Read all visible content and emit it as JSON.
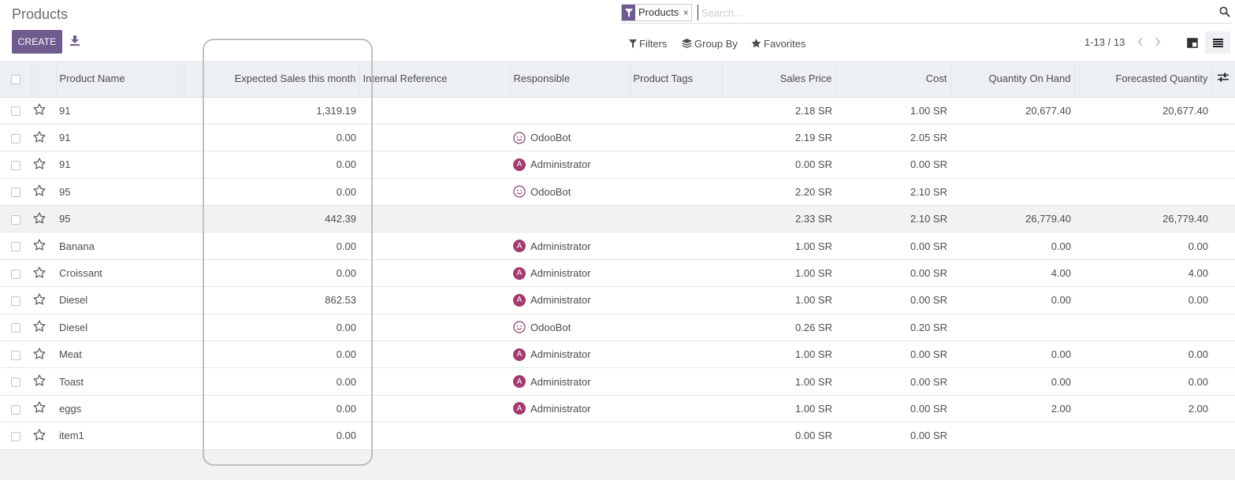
{
  "page": {
    "title": "Products"
  },
  "toolbar": {
    "create_label": "CREATE"
  },
  "search": {
    "facet_label": "Products",
    "facet_close": "×",
    "placeholder": "Search..."
  },
  "filters": {
    "filters_label": "Filters",
    "groupby_label": "Group By",
    "favorites_label": "Favorites"
  },
  "pager": {
    "value": "1-13 / 13"
  },
  "columns": {
    "name": "Product Name",
    "expected_sales": "Expected Sales this month",
    "internal_ref": "Internal Reference",
    "responsible": "Responsible",
    "tags": "Product Tags",
    "sales_price": "Sales Price",
    "cost": "Cost",
    "qty_on_hand": "Quantity On Hand",
    "forecast_qty": "Forecasted Quantity"
  },
  "rows": [
    {
      "name": "91",
      "expected": "1,319.19",
      "responsible": "",
      "avatar": "",
      "price": "2.18 SR",
      "cost": "1.00 SR",
      "qoh": "20,677.40",
      "fq": "20,677.40"
    },
    {
      "name": "91",
      "expected": "0.00",
      "responsible": "OdooBot",
      "avatar": "bot",
      "price": "2.19 SR",
      "cost": "2.05 SR",
      "qoh": "",
      "fq": ""
    },
    {
      "name": "91",
      "expected": "0.00",
      "responsible": "Administrator",
      "avatar": "A",
      "price": "0.00 SR",
      "cost": "0.00 SR",
      "qoh": "",
      "fq": ""
    },
    {
      "name": "95",
      "expected": "0.00",
      "responsible": "OdooBot",
      "avatar": "bot",
      "price": "2.20 SR",
      "cost": "2.10 SR",
      "qoh": "",
      "fq": ""
    },
    {
      "name": "95",
      "expected": "442.39",
      "responsible": "",
      "avatar": "",
      "price": "2.33 SR",
      "cost": "2.10 SR",
      "qoh": "26,779.40",
      "fq": "26,779.40"
    },
    {
      "name": "Banana",
      "expected": "0.00",
      "responsible": "Administrator",
      "avatar": "A",
      "price": "1.00 SR",
      "cost": "0.00 SR",
      "qoh": "0.00",
      "fq": "0.00"
    },
    {
      "name": "Croissant",
      "expected": "0.00",
      "responsible": "Administrator",
      "avatar": "A",
      "price": "1.00 SR",
      "cost": "0.00 SR",
      "qoh": "4.00",
      "fq": "4.00"
    },
    {
      "name": "Diesel",
      "expected": "862.53",
      "responsible": "Administrator",
      "avatar": "A",
      "price": "1.00 SR",
      "cost": "0.00 SR",
      "qoh": "0.00",
      "fq": "0.00"
    },
    {
      "name": "Diesel",
      "expected": "0.00",
      "responsible": "OdooBot",
      "avatar": "bot",
      "price": "0.26 SR",
      "cost": "0.20 SR",
      "qoh": "",
      "fq": ""
    },
    {
      "name": "Meat",
      "expected": "0.00",
      "responsible": "Administrator",
      "avatar": "A",
      "price": "1.00 SR",
      "cost": "0.00 SR",
      "qoh": "0.00",
      "fq": "0.00"
    },
    {
      "name": "Toast",
      "expected": "0.00",
      "responsible": "Administrator",
      "avatar": "A",
      "price": "1.00 SR",
      "cost": "0.00 SR",
      "qoh": "0.00",
      "fq": "0.00"
    },
    {
      "name": "eggs",
      "expected": "0.00",
      "responsible": "Administrator",
      "avatar": "A",
      "price": "1.00 SR",
      "cost": "0.00 SR",
      "qoh": "2.00",
      "fq": "2.00"
    },
    {
      "name": "item1",
      "expected": "0.00",
      "responsible": "",
      "avatar": "",
      "price": "0.00 SR",
      "cost": "0.00 SR",
      "qoh": "",
      "fq": ""
    }
  ],
  "icons": {
    "facet": "filter-icon",
    "download": "download-icon",
    "search": "search-icon",
    "filters": "filter-icon",
    "groupby": "layers-icon",
    "favorites": "star-icon",
    "kanban": "kanban-view-icon",
    "list": "list-view-icon",
    "optional_columns": "sliders-icon"
  },
  "colors": {
    "primary": "#6f5b8f",
    "avatar": "#a43a6e",
    "header_bg": "#eceff3"
  }
}
